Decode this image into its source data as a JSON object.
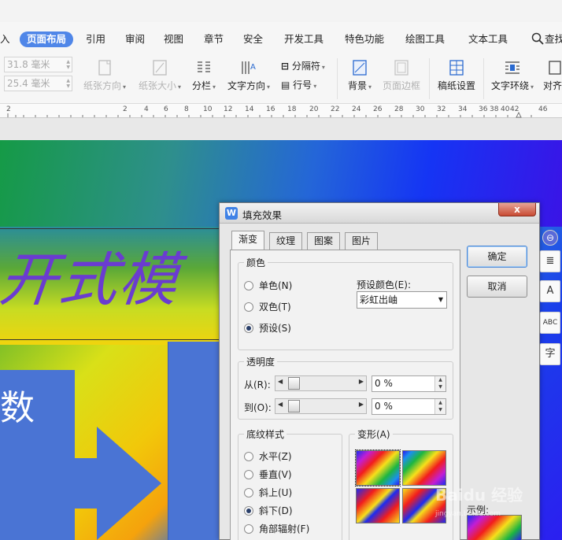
{
  "menu": {
    "tabs": [
      {
        "label": "入"
      },
      {
        "label": "页面布局"
      },
      {
        "label": "引用"
      },
      {
        "label": "审阅"
      },
      {
        "label": "视图"
      },
      {
        "label": "章节"
      },
      {
        "label": "安全"
      },
      {
        "label": "开发工具"
      },
      {
        "label": "特色功能"
      },
      {
        "label": "绘图工具"
      },
      {
        "label": "文本工具"
      },
      {
        "label": "查找"
      }
    ]
  },
  "ribbon": {
    "margin_top": "31.8 毫米",
    "margin_bottom": "25.4 毫米",
    "orientation": "纸张方向",
    "paper_size": "纸张大小",
    "columns": "分栏",
    "text_direction": "文字方向",
    "separator": "分隔符",
    "line_numbers": "行号",
    "background": "背景",
    "page_border": "页面边框",
    "manuscript": "稿纸设置",
    "text_wrap": "文字环绕",
    "align": "对齐"
  },
  "ruler": {
    "numbers": [
      "2",
      "2",
      "4",
      "6",
      "8",
      "10",
      "12",
      "14",
      "16",
      "18",
      "20",
      "22",
      "24",
      "26",
      "28",
      "30",
      "32",
      "34",
      "36",
      "38",
      "40",
      "42",
      "46"
    ]
  },
  "document": {
    "title_text": "开式模",
    "box_text": "数"
  },
  "dialog": {
    "title": "填充效果",
    "close_label": "x",
    "tabs": [
      "渐变",
      "纹理",
      "图案",
      "图片"
    ],
    "color_group": {
      "label": "颜色",
      "options": [
        "单色(N)",
        "双色(T)",
        "预设(S)"
      ],
      "selected": "预设(S)",
      "preset_label": "预设颜色(E):",
      "preset_value": "彩虹出岫"
    },
    "transparency": {
      "label": "透明度",
      "from_label": "从(R):",
      "from_value": "0 %",
      "to_label": "到(O):",
      "to_value": "0 %"
    },
    "shading": {
      "label": "底纹样式",
      "options": [
        "水平(Z)",
        "垂直(V)",
        "斜上(U)",
        "斜下(D)",
        "角部辐射(F)"
      ],
      "selected": "斜下(D)"
    },
    "variants_label": "变形(A)",
    "sample_label": "示例:",
    "ok_label": "确定",
    "cancel_label": "取消"
  },
  "side_toolbar": {
    "items": [
      "⊖",
      "≣",
      "A",
      "ABC",
      "字"
    ]
  },
  "watermark": {
    "text": "Baidu 经验",
    "sub": "jingyan.baidu.com"
  }
}
